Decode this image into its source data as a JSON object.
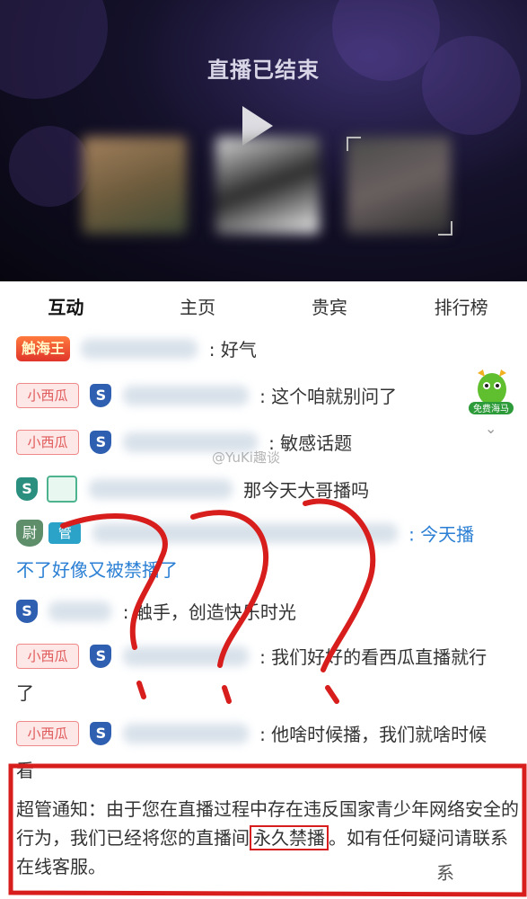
{
  "player": {
    "status_text": "直播已结束"
  },
  "tabs": [
    {
      "label": "互动",
      "active": true
    },
    {
      "label": "主页",
      "active": false
    },
    {
      "label": "贵宾",
      "active": false
    },
    {
      "label": "排行榜",
      "active": false
    }
  ],
  "chat": {
    "watermark": "@YuKi趣谈",
    "mascot_label": "免费海马",
    "messages": [
      {
        "badge": "触海王",
        "text": ": 好气"
      },
      {
        "badge": "小西瓜",
        "shield": "S",
        "text": ": 这个咱就别问了"
      },
      {
        "badge": "小西瓜",
        "shield": "S",
        "text": ": 敏感话题"
      },
      {
        "shield": "S",
        "text": "那今天大哥播吗"
      },
      {
        "badge": "尉",
        "manager_tag": "管",
        "text_line1": ": 今天播",
        "text_line2": "不了好像又被禁播了"
      },
      {
        "shield": "S",
        "text": ": 触手，创造快乐时光"
      },
      {
        "badge": "小西瓜",
        "shield": "S",
        "text_line1": ": 我们好好的看西瓜直播就行",
        "text_line2": "了"
      },
      {
        "badge": "小西瓜",
        "shield": "S",
        "text_line1": ": 他啥时候播，我们就啥时候",
        "text_line2": "看"
      }
    ]
  },
  "notice": {
    "part1": "超管通知：由于您在直播过程中存在违反国家青少年网络安全的行为，我们已经将您的直播间",
    "highlight": "永久禁播",
    "part2": "。如有任何疑问请联系在线客服。",
    "trailing": "系"
  },
  "colors": {
    "annotation_red": "#d81d1d",
    "link_blue": "#2a7fd4"
  }
}
